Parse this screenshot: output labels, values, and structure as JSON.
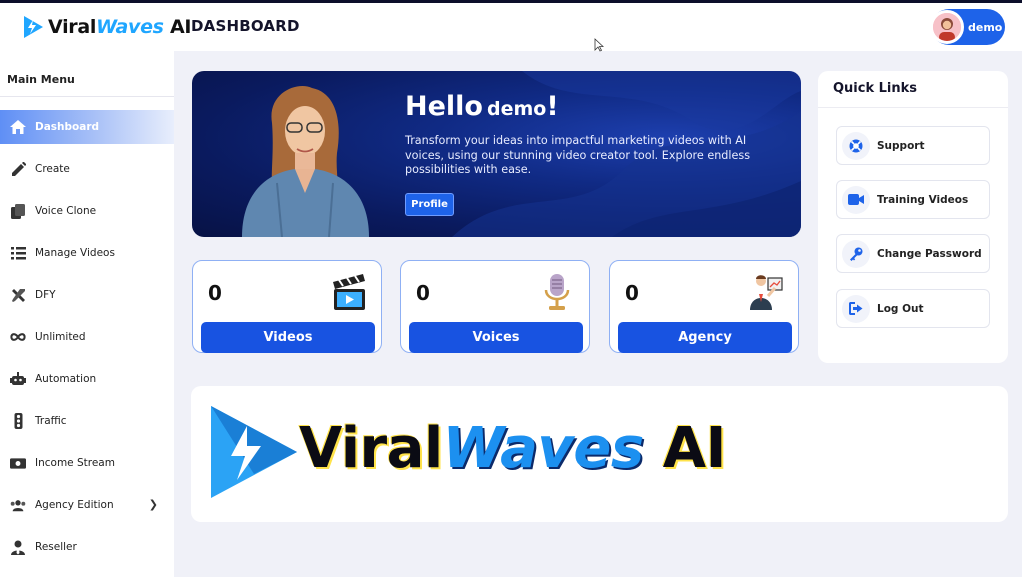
{
  "header": {
    "logo": {
      "prefix": "Viral",
      "wave": "Waves",
      "suffix": " AI"
    },
    "title": "DASHBOARD",
    "user": {
      "name": "demo"
    }
  },
  "sidebar": {
    "title": "Main Menu",
    "items": [
      {
        "label": "Dashboard",
        "icon": "home-icon",
        "active": true
      },
      {
        "label": "Create",
        "icon": "pencil-icon"
      },
      {
        "label": "Voice Clone",
        "icon": "copy-icon"
      },
      {
        "label": "Manage Videos",
        "icon": "list-icon"
      },
      {
        "label": "DFY",
        "icon": "tools-icon"
      },
      {
        "label": "Unlimited",
        "icon": "infinity-icon"
      },
      {
        "label": "Automation",
        "icon": "robot-icon"
      },
      {
        "label": "Traffic",
        "icon": "traffic-light-icon"
      },
      {
        "label": "Income Stream",
        "icon": "money-icon"
      },
      {
        "label": "Agency Edition",
        "icon": "users-icon",
        "has_submenu": true
      },
      {
        "label": "Reseller",
        "icon": "user-tie-icon"
      }
    ]
  },
  "hero": {
    "greeting": "Hello",
    "name": "demo",
    "exclaim": "!",
    "text": "Transform your ideas into impactful marketing videos with AI voices, using our stunning video creator tool. Explore endless possibilities with ease.",
    "button": "Profile"
  },
  "stats": [
    {
      "value": "0",
      "label": "Videos",
      "icon": "clapperboard-icon"
    },
    {
      "value": "0",
      "label": "Voices",
      "icon": "microphone-icon"
    },
    {
      "value": "0",
      "label": "Agency",
      "icon": "presenter-icon"
    }
  ],
  "quick_links": {
    "title": "Quick Links",
    "items": [
      {
        "label": "Support",
        "icon": "support-icon"
      },
      {
        "label": "Training Videos",
        "icon": "video-camera-icon"
      },
      {
        "label": "Change Password",
        "icon": "key-icon"
      },
      {
        "label": "Log Out",
        "icon": "logout-icon"
      }
    ]
  },
  "banner": {
    "prefix": "Viral",
    "wave": "Waves",
    "suffix": " AI"
  },
  "colors": {
    "primary": "#1e63e9",
    "hero_bg": "#0a1a5e",
    "accent": "#1fa6ff"
  }
}
